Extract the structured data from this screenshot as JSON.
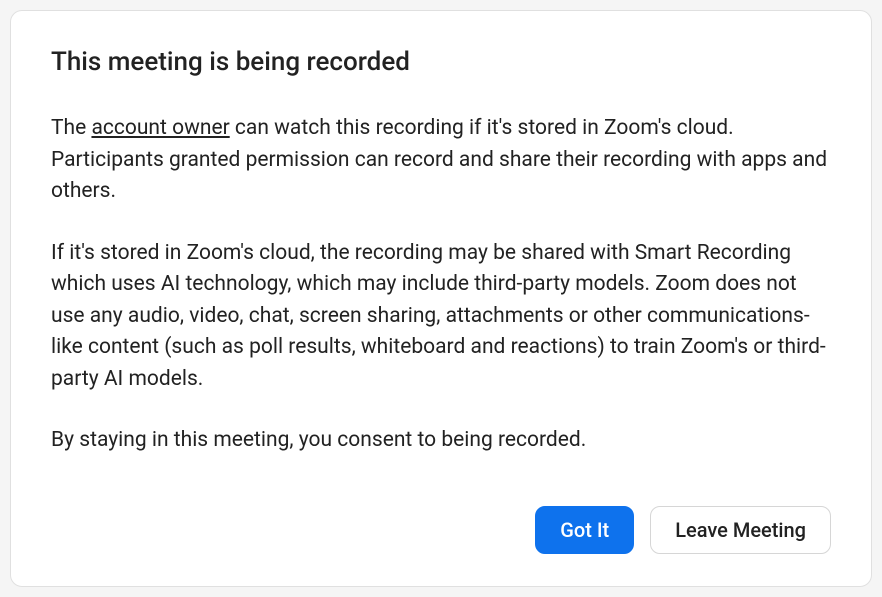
{
  "dialog": {
    "title": "This meeting is being recorded",
    "paragraph1_pre": "The ",
    "paragraph1_link": "account owner",
    "paragraph1_post": " can watch this recording if it's stored in Zoom's cloud. Participants granted permission can record and share their recording with apps and others.",
    "paragraph2": "If it's stored in Zoom's cloud, the recording may be shared with Smart Recording which uses AI technology, which may include third-party models. Zoom does not use any audio, video, chat, screen sharing, attachments or other communications-like content (such as poll results, whiteboard and reactions) to train Zoom's or third-party AI models.",
    "paragraph3": "By staying in this meeting, you consent to being recorded.",
    "actions": {
      "confirm_label": "Got It",
      "leave_label": "Leave Meeting"
    }
  }
}
